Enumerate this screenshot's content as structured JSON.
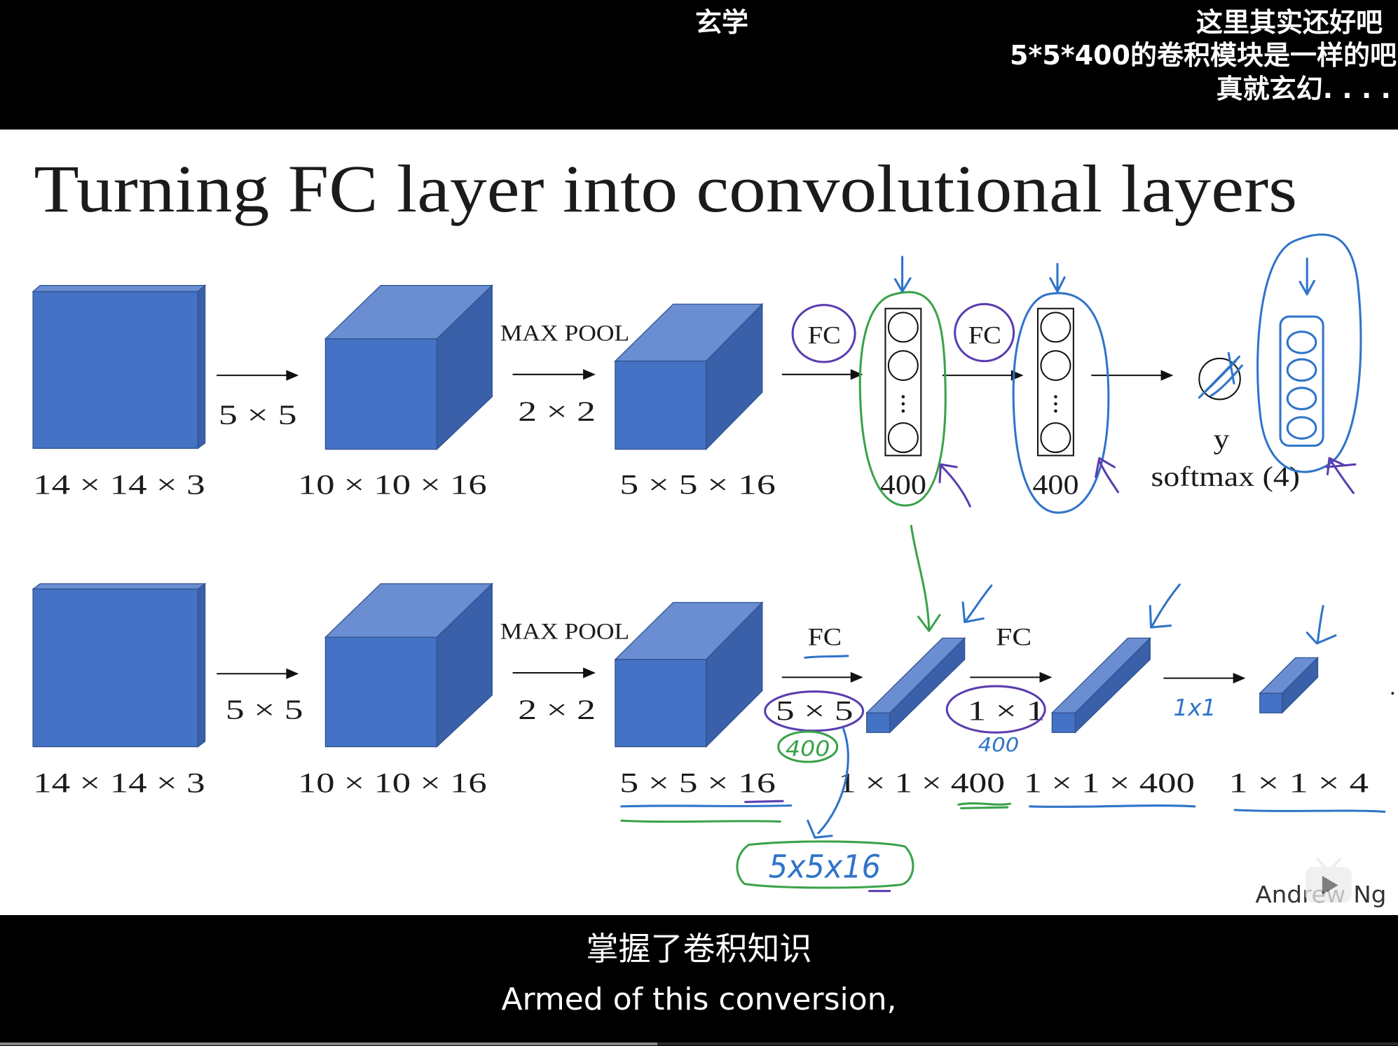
{
  "danmaku": {
    "line_1": "玄学",
    "line_2": "这里其实还好吧",
    "line_3": "5*5*400的卷积模块是一样的吧",
    "line_4": "真就玄幻. . . ."
  },
  "slide": {
    "title": "Turning FC layer into convolutional layers",
    "top_row": {
      "input_dims": "14 × 14 × 3",
      "conv_kernel": "5 × 5",
      "conv_dims": "10 × 10 × 16",
      "pool_label": "MAX POOL",
      "pool_size": "2 × 2",
      "pool_dims": "5 × 5 × 16",
      "fc1_label": "FC",
      "fc1_units": "400",
      "fc2_label": "FC",
      "fc2_units": "400",
      "output_label": "y",
      "output_activation": "softmax (4)"
    },
    "bottom_row": {
      "input_dims": "14 × 14 × 3",
      "conv_kernel": "5 × 5",
      "conv_dims": "10 × 10 × 16",
      "pool_label": "MAX POOL",
      "pool_size": "2 × 2",
      "pool_dims": "5 × 5 × 16",
      "fc1_label": "FC",
      "fc1_kernel": "5 × 5",
      "fc1_dims": "1 × 1 × 400",
      "fc2_label": "FC",
      "fc2_kernel": "1 × 1",
      "fc2_dims": "1 × 1 × 400",
      "output_dims": "1 × 1 × 4"
    },
    "handwritten": {
      "fc1_filters": "400",
      "fc2_filters": "400",
      "output_kernel": "1x1",
      "fc1_filter_shape": "5x5x16"
    },
    "author": "Andrew Ng"
  },
  "subtitles": {
    "chinese": "掌握了卷积知识",
    "english": "Armed of this conversion,"
  },
  "player": {
    "progress": 0.47
  },
  "colors": {
    "volume_front": "#4472C4",
    "volume_top": "#6B8ED3",
    "volume_side": "#3A60A9",
    "ink_green": "#3AA24A",
    "ink_blue": "#2F74C9",
    "ink_purple": "#5B3DB0"
  }
}
